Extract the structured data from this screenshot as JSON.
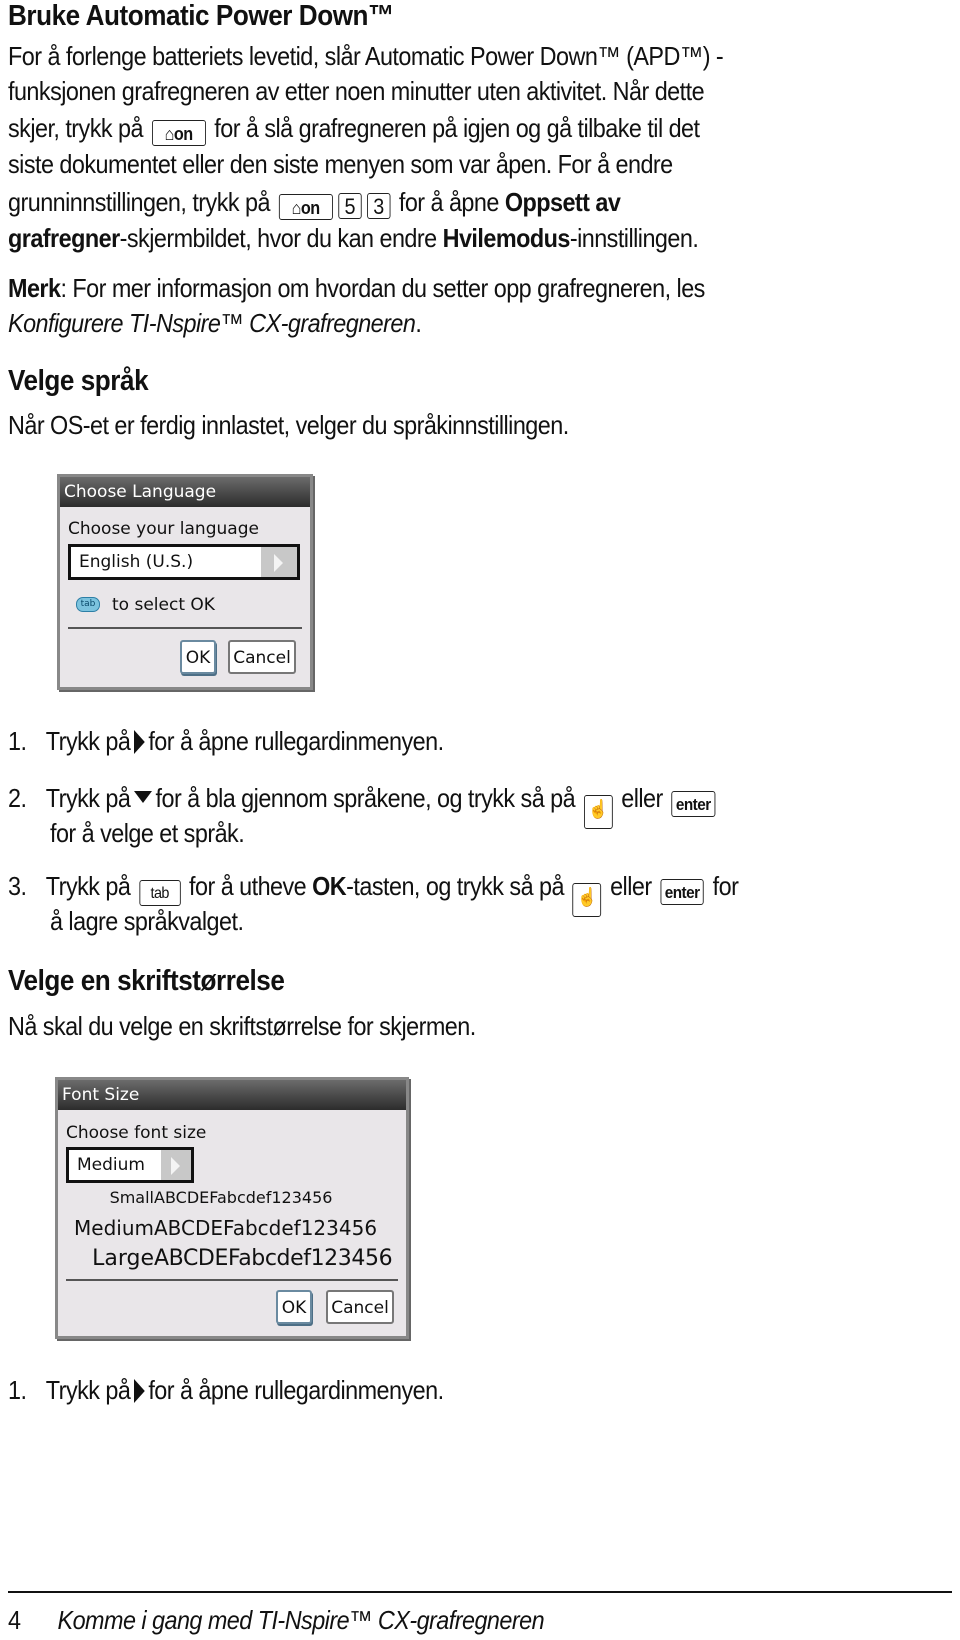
{
  "section_apd": {
    "heading": "Bruke Automatic Power Down™",
    "p1_line1": "For å forlenge batteriets levetid, slår Automatic Power Down™ (APD™) -",
    "p1_line2": "funksjonen grafregneren av etter noen minutter uten aktivitet. Når dette",
    "p1_line3_pre": "skjer, trykk på",
    "p1_line3_post": "for å slå grafregneren på igjen og gå tilbake til det",
    "p1_line4": "siste dokumentet eller den siste menyen som var åpen. For å endre",
    "p1_line5_pre": "grunninnstillingen, trykk på",
    "p1_line5_post": "for å åpne",
    "p1_line5_bold": "Oppsett av",
    "p1_line6_bold": "grafregner",
    "p1_line6_mid": "-skjermbildet, hvor du kan endre",
    "p1_line6_bold2": "Hvilemodus",
    "p1_line6_post": "-innstillingen.",
    "keys": {
      "home_on": "on",
      "five": "5",
      "three": "3"
    },
    "note_label": "Merk",
    "note_text": ": For mer informasjon om hvordan du setter opp grafregneren, les",
    "note_link": "Konfigurere TI-Nspire™ CX-grafregneren",
    "note_end": "."
  },
  "section_language": {
    "heading": "Velge språk",
    "intro": "Når OS-et er ferdig innlastet, velger du språkinnstillingen.",
    "dialog": {
      "title": "Choose Language",
      "label": "Choose your language",
      "selected_value": "English (U.S.)",
      "hint_key": "tab",
      "hint_text": "to select OK",
      "ok_label": "OK",
      "cancel_label": "Cancel"
    },
    "steps": [
      {
        "num": "1.",
        "pre": "Trykk på",
        "post": "for å åpne rullegardinmenyen."
      },
      {
        "num": "2.",
        "pre": "Trykk på",
        "mid": "for å bla gjennom språkene, og trykk så på",
        "or": "eller",
        "key_enter": "enter",
        "line2": "for å velge et språk."
      },
      {
        "num": "3.",
        "pre": "Trykk på",
        "key_tab": "tab",
        "mid1": "for å utheve",
        "bold": "OK",
        "mid2": "-tasten, og trykk så på",
        "or": "eller",
        "key_enter": "enter",
        "post": "for",
        "line2": "å lagre språkvalget."
      }
    ]
  },
  "section_font": {
    "heading": "Velge en skriftstørrelse",
    "intro": "Nå skal du velge en skriftstørrelse for skjermen.",
    "dialog": {
      "title": "Font Size",
      "label": "Choose font size",
      "selected_value": "Medium",
      "samples": [
        {
          "label": "Small",
          "text": "ABCDEFabcdef123456"
        },
        {
          "label": "Medium",
          "text": "ABCDEFabcdef123456"
        },
        {
          "label": "Large",
          "text": "ABCDEFabcdef123456"
        }
      ],
      "ok_label": "OK",
      "cancel_label": "Cancel"
    },
    "steps": [
      {
        "num": "1.",
        "pre": "Trykk på",
        "post": "for å åpne rullegardinmenyen."
      }
    ]
  },
  "footer": {
    "page_number": "4",
    "title": "Komme i gang med TI-Nspire™ CX-grafregneren"
  }
}
